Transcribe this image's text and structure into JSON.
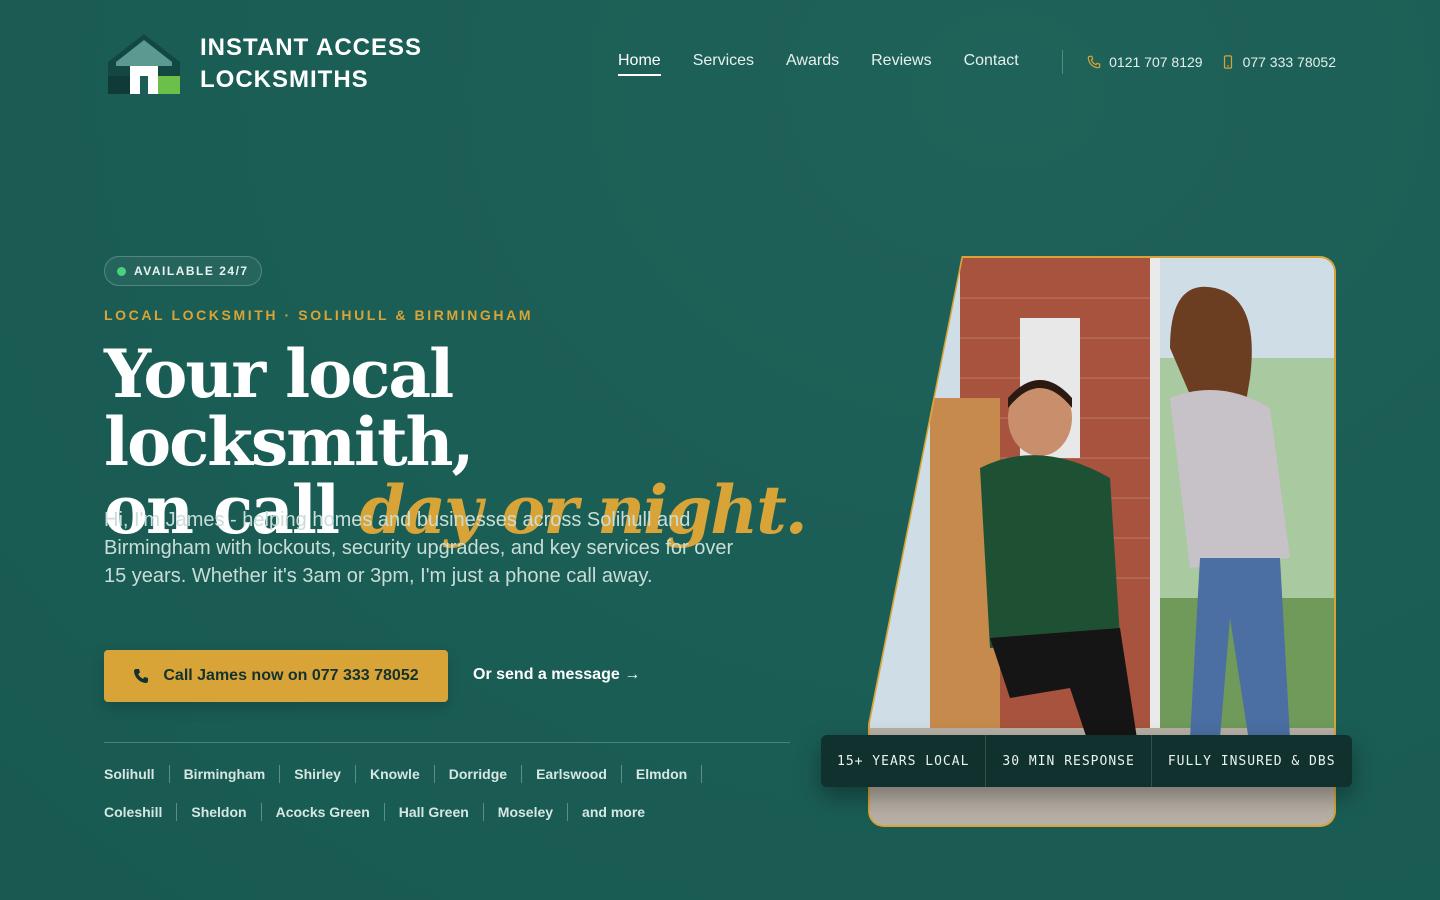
{
  "brand": {
    "line1": "INSTANT ACCESS",
    "line2": "LOCKSMITHS"
  },
  "nav": [
    {
      "label": "Home",
      "active": true
    },
    {
      "label": "Services"
    },
    {
      "label": "Awards"
    },
    {
      "label": "Reviews"
    },
    {
      "label": "Contact"
    }
  ],
  "phones": {
    "landline": "0121 707 8129",
    "mobile": "077 333 78052"
  },
  "hero": {
    "badge": "AVAILABLE 24/7",
    "eyebrow": "LOCAL LOCKSMITH · SOLIHULL & BIRMINGHAM",
    "headline_line1": "Your local locksmith,",
    "headline_line2_plain": "on call",
    "headline_line2_accent": "day or night.",
    "intro": "Hi, I'm James - helping homes and businesses across Solihull and Birmingham with lockouts, security upgrades, and key services for over 15 years. Whether it's 3am or 3pm, I'm just a phone call away.",
    "cta_label": "Call James now on 077 333 78052",
    "secondary_label": "Or send a message →"
  },
  "areas": [
    "Solihull",
    "Birmingham",
    "Shirley",
    "Knowle",
    "Dorridge",
    "Earlswood",
    "Elmdon",
    "Coleshill",
    "Sheldon",
    "Acocks Green",
    "Hall Green",
    "Moseley",
    "and more"
  ],
  "stats": [
    "15+ YEARS LOCAL",
    "30 MIN RESPONSE",
    "FULLY INSURED & DBS"
  ],
  "colors": {
    "background": "#1b5e55",
    "accent": "#d9a437",
    "status_green": "#48d27b",
    "dark_panel": "#10312d"
  }
}
